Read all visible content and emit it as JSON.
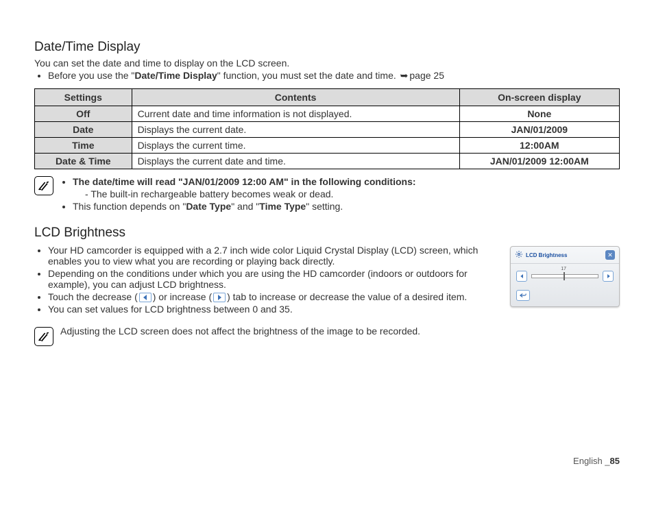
{
  "section1": {
    "title": "Date/Time Display",
    "intro": "You can set the date and time to display on the LCD screen.",
    "bullet_prefix": "Before you use the \"",
    "bullet_em": "Date/Time Display",
    "bullet_suffix": "\" function, you must set the date and time. ",
    "page_ref": "page 25"
  },
  "table": {
    "headers": [
      "Settings",
      "Contents",
      "On-screen display"
    ],
    "rows": [
      {
        "s": "Off",
        "c": "Current date and time information is not displayed.",
        "d": "None"
      },
      {
        "s": "Date",
        "c": "Displays the current date.",
        "d": "JAN/01/2009"
      },
      {
        "s": "Time",
        "c": "Displays the current time.",
        "d": "12:00AM"
      },
      {
        "s": "Date & Time",
        "c": "Displays the current date and time.",
        "d": "JAN/01/2009 12:00AM"
      }
    ]
  },
  "note1": {
    "line1": "The date/time will read \"JAN/01/2009 12:00 AM\" in the following conditions:",
    "sub1": "The built-in rechargeable battery becomes weak or dead.",
    "line2_a": "This function depends on \"",
    "line2_b": "Date Type",
    "line2_c": "\" and \"",
    "line2_d": "Time Type",
    "line2_e": "\" setting."
  },
  "section2": {
    "title": "LCD Brightness",
    "b1": "Your HD camcorder is equipped with a 2.7 inch wide color Liquid Crystal Display (LCD) screen, which enables you to view what you are recording or playing back directly.",
    "b2": "Depending on the conditions under which you are using the HD camcorder (indoors or outdoors for example), you can adjust LCD brightness.",
    "b3a": "Touch the decrease (",
    "b3b": ") or increase (",
    "b3c": ") tab to increase or decrease the value of a desired item.",
    "b4": "You can set values for LCD brightness between 0 and 35."
  },
  "note2": "Adjusting the LCD screen does not affect the brightness of the image to be recorded.",
  "lcd": {
    "title": "LCD Brightness",
    "value": "17"
  },
  "footer": {
    "lang": "English _",
    "page": "85"
  }
}
